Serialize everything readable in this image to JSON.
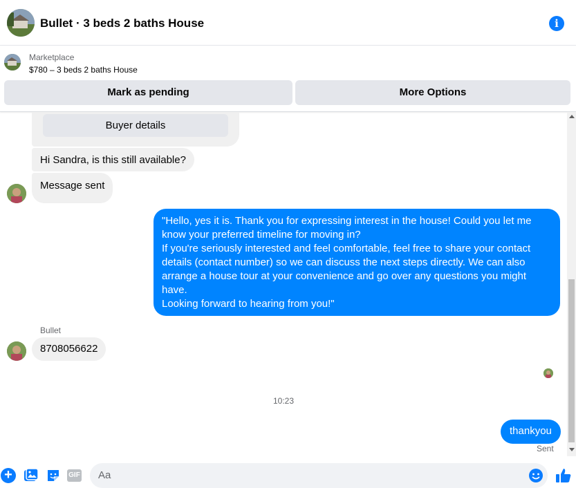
{
  "header": {
    "title": "Bullet · 3 beds 2 baths House",
    "info_icon": "info-icon"
  },
  "listing": {
    "source": "Marketplace",
    "price_title": "$780 – 3 beds 2 baths House",
    "pending_label": "Mark as pending",
    "more_label": "More Options"
  },
  "messages": {
    "buyer_details_label": "Buyer details",
    "auto_question": "Hi Sandra, is this still available?",
    "message_sent": "Message sent",
    "reply_long": "\"Hello, yes it is. Thank you for expressing interest in the house! Could you let me know your preferred timeline for moving in?\nIf you're seriously interested and feel comfortable, feel free to share your contact details (contact number) so we can discuss the next steps directly. We can also arrange a house tour at your convenience and go over any questions you might have.\nLooking forward to hearing from you!\"",
    "sender_name": "Bullet",
    "phone_message": "8708056622",
    "timestamp": "10:23",
    "reply_short": "thankyou",
    "status": "Sent"
  },
  "composer": {
    "placeholder": "Aa",
    "gif_label": "GIF"
  },
  "colors": {
    "accent": "#0a7cff",
    "outgoing_bubble": "#0084ff",
    "incoming_bubble": "#f0f0f0",
    "button_bg": "#e4e6eb"
  }
}
